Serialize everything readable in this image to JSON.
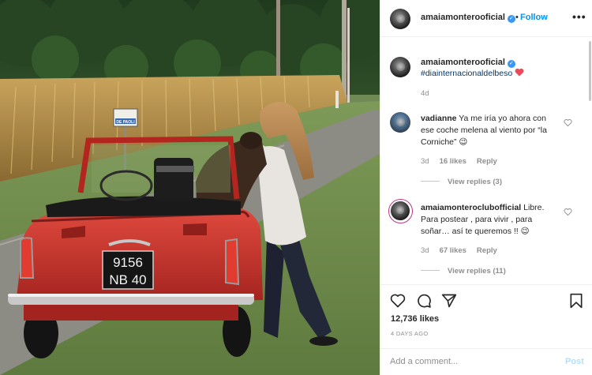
{
  "post": {
    "author": "amaiamonterooficial",
    "follow_label": "Follow",
    "separator": "•",
    "more_label": "•••"
  },
  "caption": {
    "username": "amaiamonterooficial",
    "hashtag": "#diainternacionaldelbeso",
    "time": "4d"
  },
  "comments": [
    {
      "username": "vadianne",
      "text": " Ya me iría yo ahora con ese coche melena al viento por “la Corniche” 😉",
      "time": "3d",
      "likes": "16 likes",
      "reply_label": "Reply",
      "view_replies": "View replies (3)"
    },
    {
      "username": "amaiamonteroclubofficial",
      "text": " Libre. Para postear , para vivir , para soñar… así te queremos !! 😉",
      "time": "3d",
      "likes": "67 likes",
      "reply_label": "Reply",
      "view_replies": "View replies (11)"
    }
  ],
  "stats": {
    "likes": "12,736 likes",
    "ago": "4 DAYS AGO"
  },
  "composer": {
    "placeholder": "Add a comment...",
    "post_label": "Post"
  },
  "photo": {
    "plate_line1": "9156",
    "plate_line2": "NB 40",
    "sign_text": "DE PAOLI"
  },
  "colors": {
    "accent": "#0095f6",
    "verified": "#3897f0",
    "heart": "#ed4956",
    "car_red": "#c8312c"
  },
  "icons": [
    "verified-badge-icon",
    "heart-icon",
    "comment-icon",
    "share-icon",
    "bookmark-icon",
    "more-options-icon"
  ]
}
